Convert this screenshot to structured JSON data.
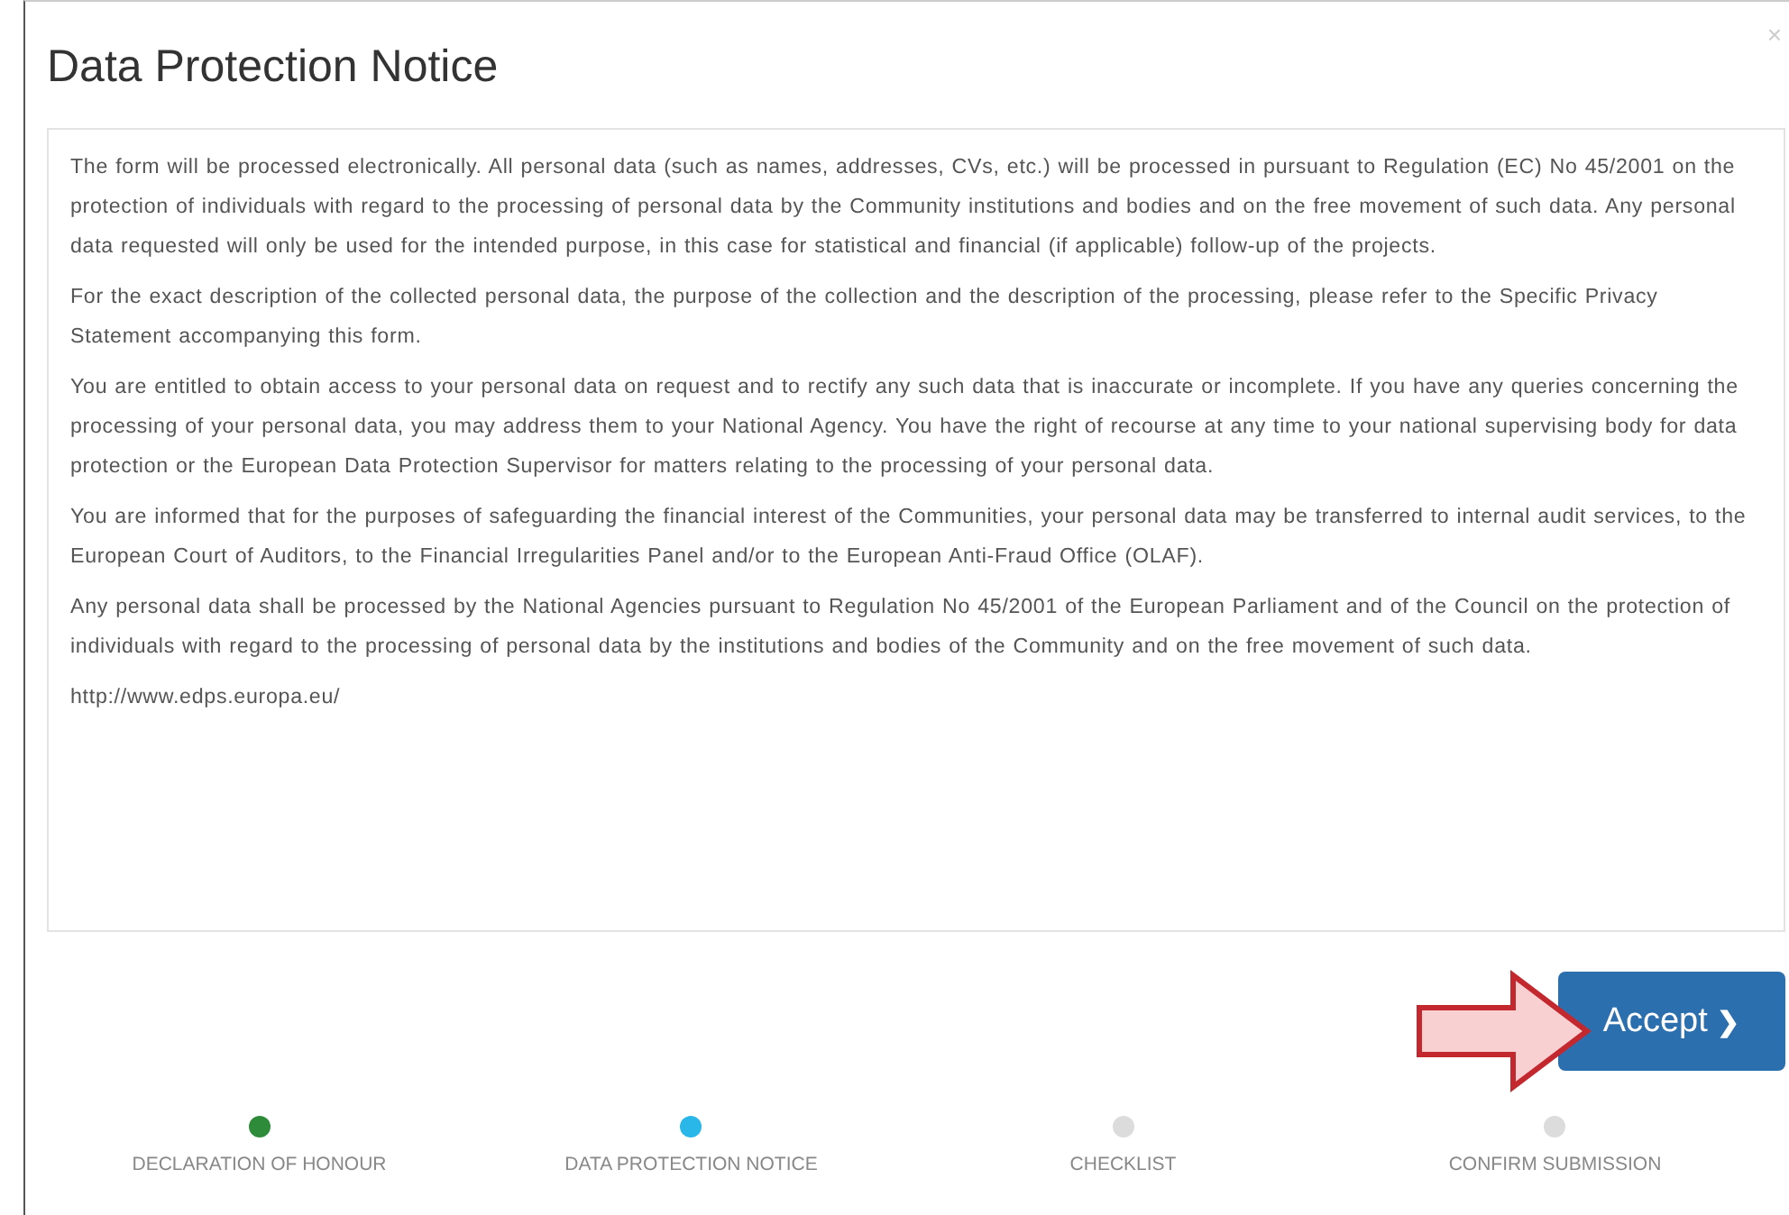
{
  "dialog": {
    "title": "Data Protection Notice",
    "close": "×"
  },
  "paragraphs": [
    "The form will be processed electronically. All personal data (such as names, addresses, CVs, etc.) will be processed in pursuant to Regulation (EC) No 45/2001 on the protection of individuals with regard to the processing of personal data by the Community institutions and bodies and on the free movement of such data. Any personal data requested will only be used for the intended purpose, in this case for statistical and financial (if applicable) follow-up of the projects.",
    "For the exact description of the collected personal data, the purpose of the collection and the description of the processing, please refer to the Specific Privacy Statement accompanying this form.",
    "You are entitled to obtain access to your personal data on request and to rectify any such data that is inaccurate or incomplete. If you have any queries concerning the processing of your personal data, you may address them to your National Agency. You have the right of recourse at any time to your national supervising body for data protection or the European Data Protection Supervisor for matters relating to the processing of your personal data.",
    "You are informed that for the purposes of safeguarding the financial interest of the Communities, your personal data may be transferred to internal audit services, to the European Court of Auditors, to the Financial Irregularities Panel and/or to the European Anti-Fraud Office (OLAF).",
    "Any personal data shall be processed by the National Agencies pursuant to Regulation No 45/2001 of the European Parliament and of the Council on the protection of individuals with regard to the processing of personal data by the institutions and bodies of the Community and on the free movement of such data."
  ],
  "link": "http://www.edps.europa.eu/",
  "accept_button": {
    "label": "Accept",
    "icon": "❯"
  },
  "steps": [
    {
      "label": "DECLARATION OF HONOUR",
      "color": "#2e8b3a"
    },
    {
      "label": "DATA PROTECTION NOTICE",
      "color": "#29b6e8"
    },
    {
      "label": "CHECKLIST",
      "color": "#dcdcdc"
    },
    {
      "label": "CONFIRM SUBMISSION",
      "color": "#dcdcdc"
    }
  ]
}
